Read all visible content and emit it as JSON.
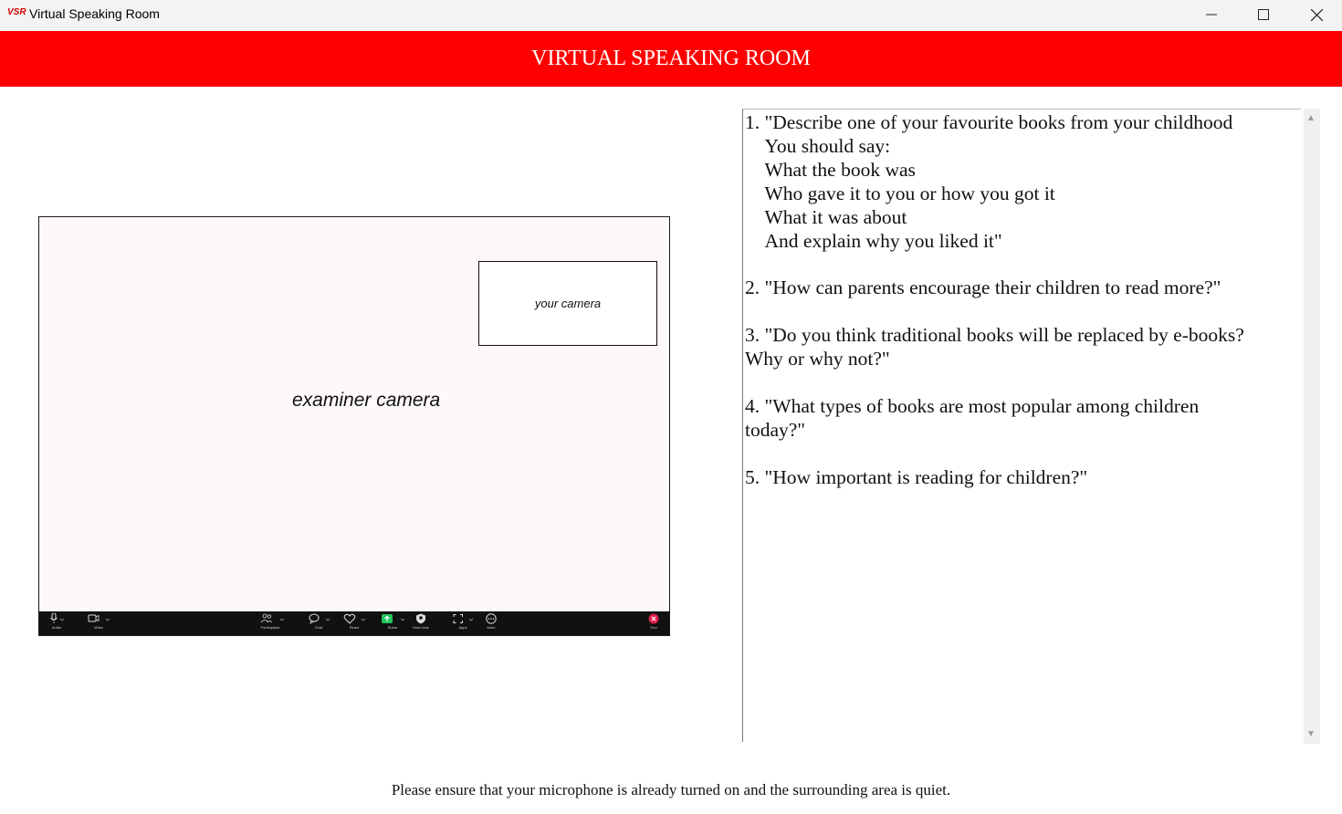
{
  "window": {
    "title": "Virtual Speaking Room",
    "icon": "app-logo-icon",
    "icon_text": "VSR"
  },
  "header": {
    "title": "VIRTUAL SPEAKING ROOM",
    "background": "#ff0000"
  },
  "video": {
    "examiner_label": "examiner camera",
    "self_label": "your camera",
    "toolbar": [
      {
        "label": "Audio",
        "icon": "microphone-icon"
      },
      {
        "label": "Video",
        "icon": "video-camera-icon"
      },
      {
        "label": "Participants",
        "icon": "participants-icon",
        "count": "2"
      },
      {
        "label": "Chat",
        "icon": "chat-icon"
      },
      {
        "label": "React",
        "icon": "heart-icon"
      },
      {
        "label": "Share",
        "icon": "share-screen-icon"
      },
      {
        "label": "Host tools",
        "icon": "shield-icon"
      },
      {
        "label": "Apps",
        "icon": "apps-icon"
      },
      {
        "label": "More",
        "icon": "more-icon"
      },
      {
        "label": "End",
        "icon": "end-call-icon"
      }
    ]
  },
  "questions": "1. \"Describe one of your favourite books from your childhood\n    You should say:\n    What the book was\n    Who gave it to you or how you got it\n    What it was about\n    And explain why you liked it\"\n\n2. \"How can parents encourage their children to read more?\"\n\n3. \"Do you think traditional books will be replaced by e-books?\nWhy or why not?\"\n\n4. \"What types of books are most popular among children\ntoday?\"\n\n5. \"How important is reading for children?\"",
  "footer": {
    "note": "Please ensure that your microphone is already turned on and the surrounding area is quiet."
  }
}
